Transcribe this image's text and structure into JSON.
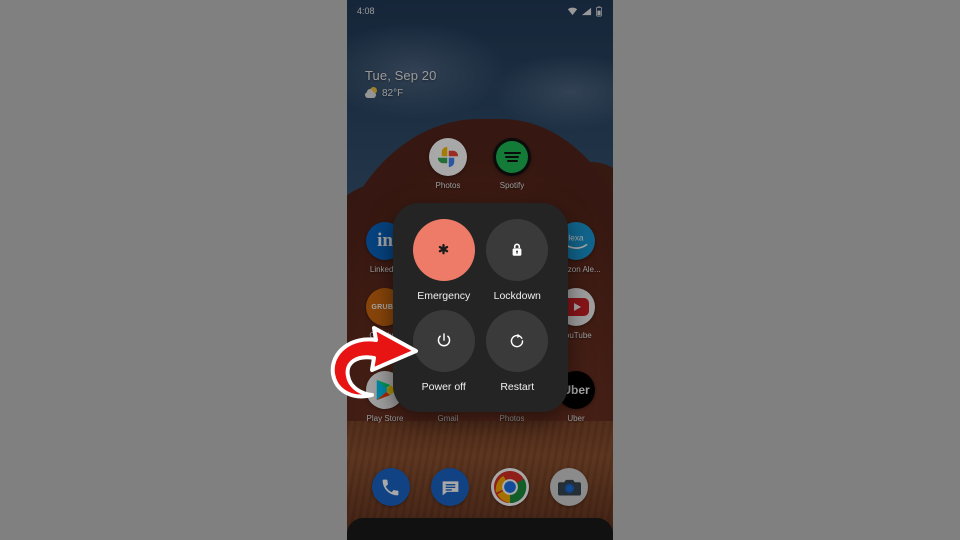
{
  "background": {
    "color": "#808080"
  },
  "device": {
    "screen_bg": "#2b435f",
    "wallpaper_description": "desert mesa with blue sky"
  },
  "status_bar": {
    "time": "4:08",
    "icons": [
      "wifi-icon",
      "cellular-signal-icon",
      "battery-icon"
    ]
  },
  "at_a_glance": {
    "date": "Tue, Sep 20",
    "temperature": "82°F",
    "weather_icon": "partly-cloudy-icon"
  },
  "home_screen": {
    "apps": [
      {
        "label": "Photos",
        "icon": "google-photos-icon"
      },
      {
        "label": "Spotify",
        "icon": "spotify-icon"
      },
      {
        "label": "LinkedIn",
        "icon": "linkedin-icon"
      },
      {
        "label": "Amazon Ale...",
        "icon": "amazon-alexa-icon"
      },
      {
        "label": "Grubhub",
        "icon": "grubhub-icon",
        "short": "GRUBH"
      },
      {
        "label": "YouTube",
        "icon": "youtube-icon"
      },
      {
        "label": "Play Store",
        "icon": "google-play-icon"
      },
      {
        "label": "Gmail",
        "icon": "gmail-icon"
      },
      {
        "label": "Photos",
        "icon": "google-photos-icon"
      },
      {
        "label": "Uber",
        "icon": "uber-icon",
        "short": "Uber"
      }
    ]
  },
  "dock": {
    "apps": [
      {
        "label": "Phone",
        "icon": "phone-icon"
      },
      {
        "label": "Messages",
        "icon": "messages-icon"
      },
      {
        "label": "Chrome",
        "icon": "chrome-icon"
      },
      {
        "label": "Camera",
        "icon": "camera-icon"
      }
    ]
  },
  "power_menu": {
    "accent_color": "#ee7b68",
    "surface_color": "#242424",
    "options": [
      {
        "label": "Emergency",
        "icon": "emergency-asterisk-icon",
        "highlighted": true
      },
      {
        "label": "Lockdown",
        "icon": "lock-icon",
        "highlighted": false
      },
      {
        "label": "Power off",
        "icon": "power-icon",
        "highlighted": false
      },
      {
        "label": "Restart",
        "icon": "restart-icon",
        "highlighted": false
      }
    ]
  },
  "annotation": {
    "arrow": {
      "color": "#e81313",
      "outline": "#ffffff",
      "points_to": "Power off"
    }
  }
}
